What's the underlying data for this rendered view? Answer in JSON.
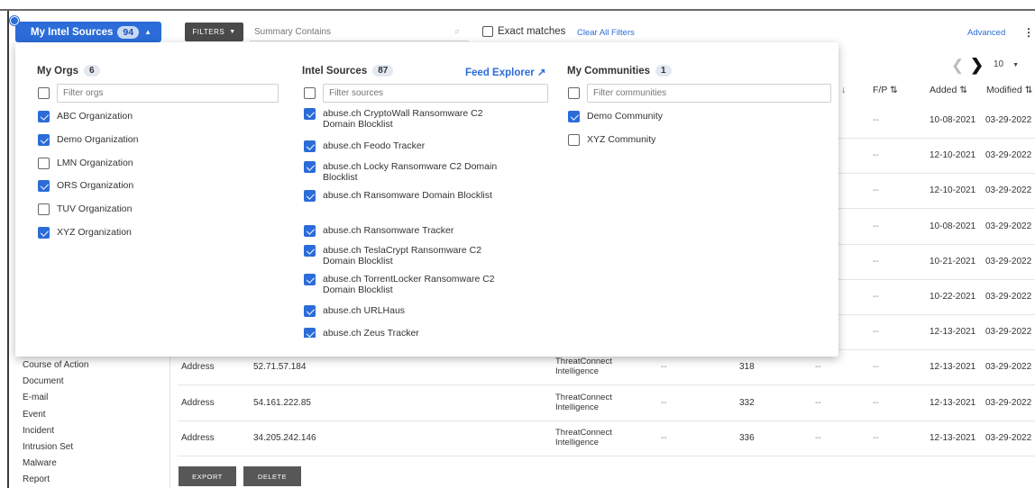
{
  "header": {
    "intel_button_label": "My Intel Sources",
    "intel_button_count": "94",
    "filters_label": "FILTERS",
    "summary_placeholder": "Summary Contains",
    "exact_matches_label": "Exact matches",
    "clear_filters_label": "Clear All Filters",
    "advanced_label": "Advanced"
  },
  "pager": {
    "page_size": "10"
  },
  "table": {
    "headers": [
      "F/P ⇅",
      "Added ⇅",
      "Modified ⇅"
    ],
    "rows": [
      {
        "type": "",
        "summary": "",
        "owner": "",
        "fp": "--",
        "added": "10-08-2021",
        "modified": "03-29-2022"
      },
      {
        "type": "",
        "summary": "",
        "owner": "",
        "fp": "--",
        "added": "12-10-2021",
        "modified": "03-29-2022"
      },
      {
        "type": "",
        "summary": "",
        "owner": "",
        "fp": "--",
        "added": "12-10-2021",
        "modified": "03-29-2022"
      },
      {
        "type": "",
        "summary": "",
        "owner": "",
        "fp": "--",
        "added": "10-08-2021",
        "modified": "03-29-2022"
      },
      {
        "type": "",
        "summary": "",
        "owner": "",
        "fp": "--",
        "added": "10-21-2021",
        "modified": "03-29-2022"
      },
      {
        "type": "",
        "summary": "",
        "owner": "",
        "fp": "--",
        "added": "10-22-2021",
        "modified": "03-29-2022"
      },
      {
        "type": "",
        "summary": "",
        "owner": "",
        "fp": "--",
        "added": "12-13-2021",
        "modified": "03-29-2022"
      },
      {
        "type": "Address",
        "summary": "52.71.57.184",
        "owner": "ThreatConnect Intelligence",
        "c1": "--",
        "c2": "318",
        "c3": "--",
        "fp": "--",
        "added": "12-13-2021",
        "modified": "03-29-2022"
      },
      {
        "type": "Address",
        "summary": "54.161.222.85",
        "owner": "ThreatConnect Intelligence",
        "c1": "--",
        "c2": "332",
        "c3": "--",
        "fp": "--",
        "added": "12-13-2021",
        "modified": "03-29-2022"
      },
      {
        "type": "Address",
        "summary": "34.205.242.146",
        "owner": "ThreatConnect Intelligence",
        "c1": "--",
        "c2": "336",
        "c3": "--",
        "fp": "--",
        "added": "12-13-2021",
        "modified": "03-29-2022"
      }
    ]
  },
  "sidebar": {
    "items": [
      "Course of Action",
      "Document",
      "E-mail",
      "Event",
      "Incident",
      "Intrusion Set",
      "Malware",
      "Report"
    ]
  },
  "actions": {
    "export_label": "EXPORT",
    "delete_label": "DELETE"
  },
  "panel": {
    "orgs": {
      "title": "My Orgs",
      "count": "6",
      "placeholder": "Filter orgs",
      "items": [
        {
          "label": "ABC Organization",
          "checked": true
        },
        {
          "label": "Demo Organization",
          "checked": true
        },
        {
          "label": "LMN Organization",
          "checked": false
        },
        {
          "label": "ORS Organization",
          "checked": true
        },
        {
          "label": "TUV Organization",
          "checked": false
        },
        {
          "label": "XYZ Organization",
          "checked": true
        }
      ]
    },
    "sources": {
      "title": "Intel Sources",
      "count": "87",
      "feed_explorer_label": "Feed Explorer ↗",
      "placeholder": "Filter sources",
      "items": [
        {
          "label": "abuse.ch CryptoWall Ransomware C2 Domain Blocklist",
          "checked": true
        },
        {
          "label": "abuse.ch Feodo Tracker",
          "checked": true
        },
        {
          "label": "abuse.ch Locky Ransomware C2 Domain Blocklist",
          "checked": true
        },
        {
          "label": "abuse.ch Ransomware Domain Blocklist",
          "checked": true
        },
        {
          "label": "abuse.ch Ransomware Tracker",
          "checked": true
        },
        {
          "label": "abuse.ch TeslaCrypt Ransomware C2 Domain Blocklist",
          "checked": true
        },
        {
          "label": "abuse.ch TorrentLocker Ransomware C2 Domain Blocklist",
          "checked": true
        },
        {
          "label": "abuse.ch URLHaus",
          "checked": true
        },
        {
          "label": "abuse.ch Zeus Tracker",
          "checked": true
        }
      ]
    },
    "communities": {
      "title": "My Communities",
      "count": "1",
      "placeholder": "Filter communities",
      "items": [
        {
          "label": "Demo Community",
          "checked": true
        },
        {
          "label": "XYZ Community",
          "checked": false
        }
      ]
    }
  }
}
